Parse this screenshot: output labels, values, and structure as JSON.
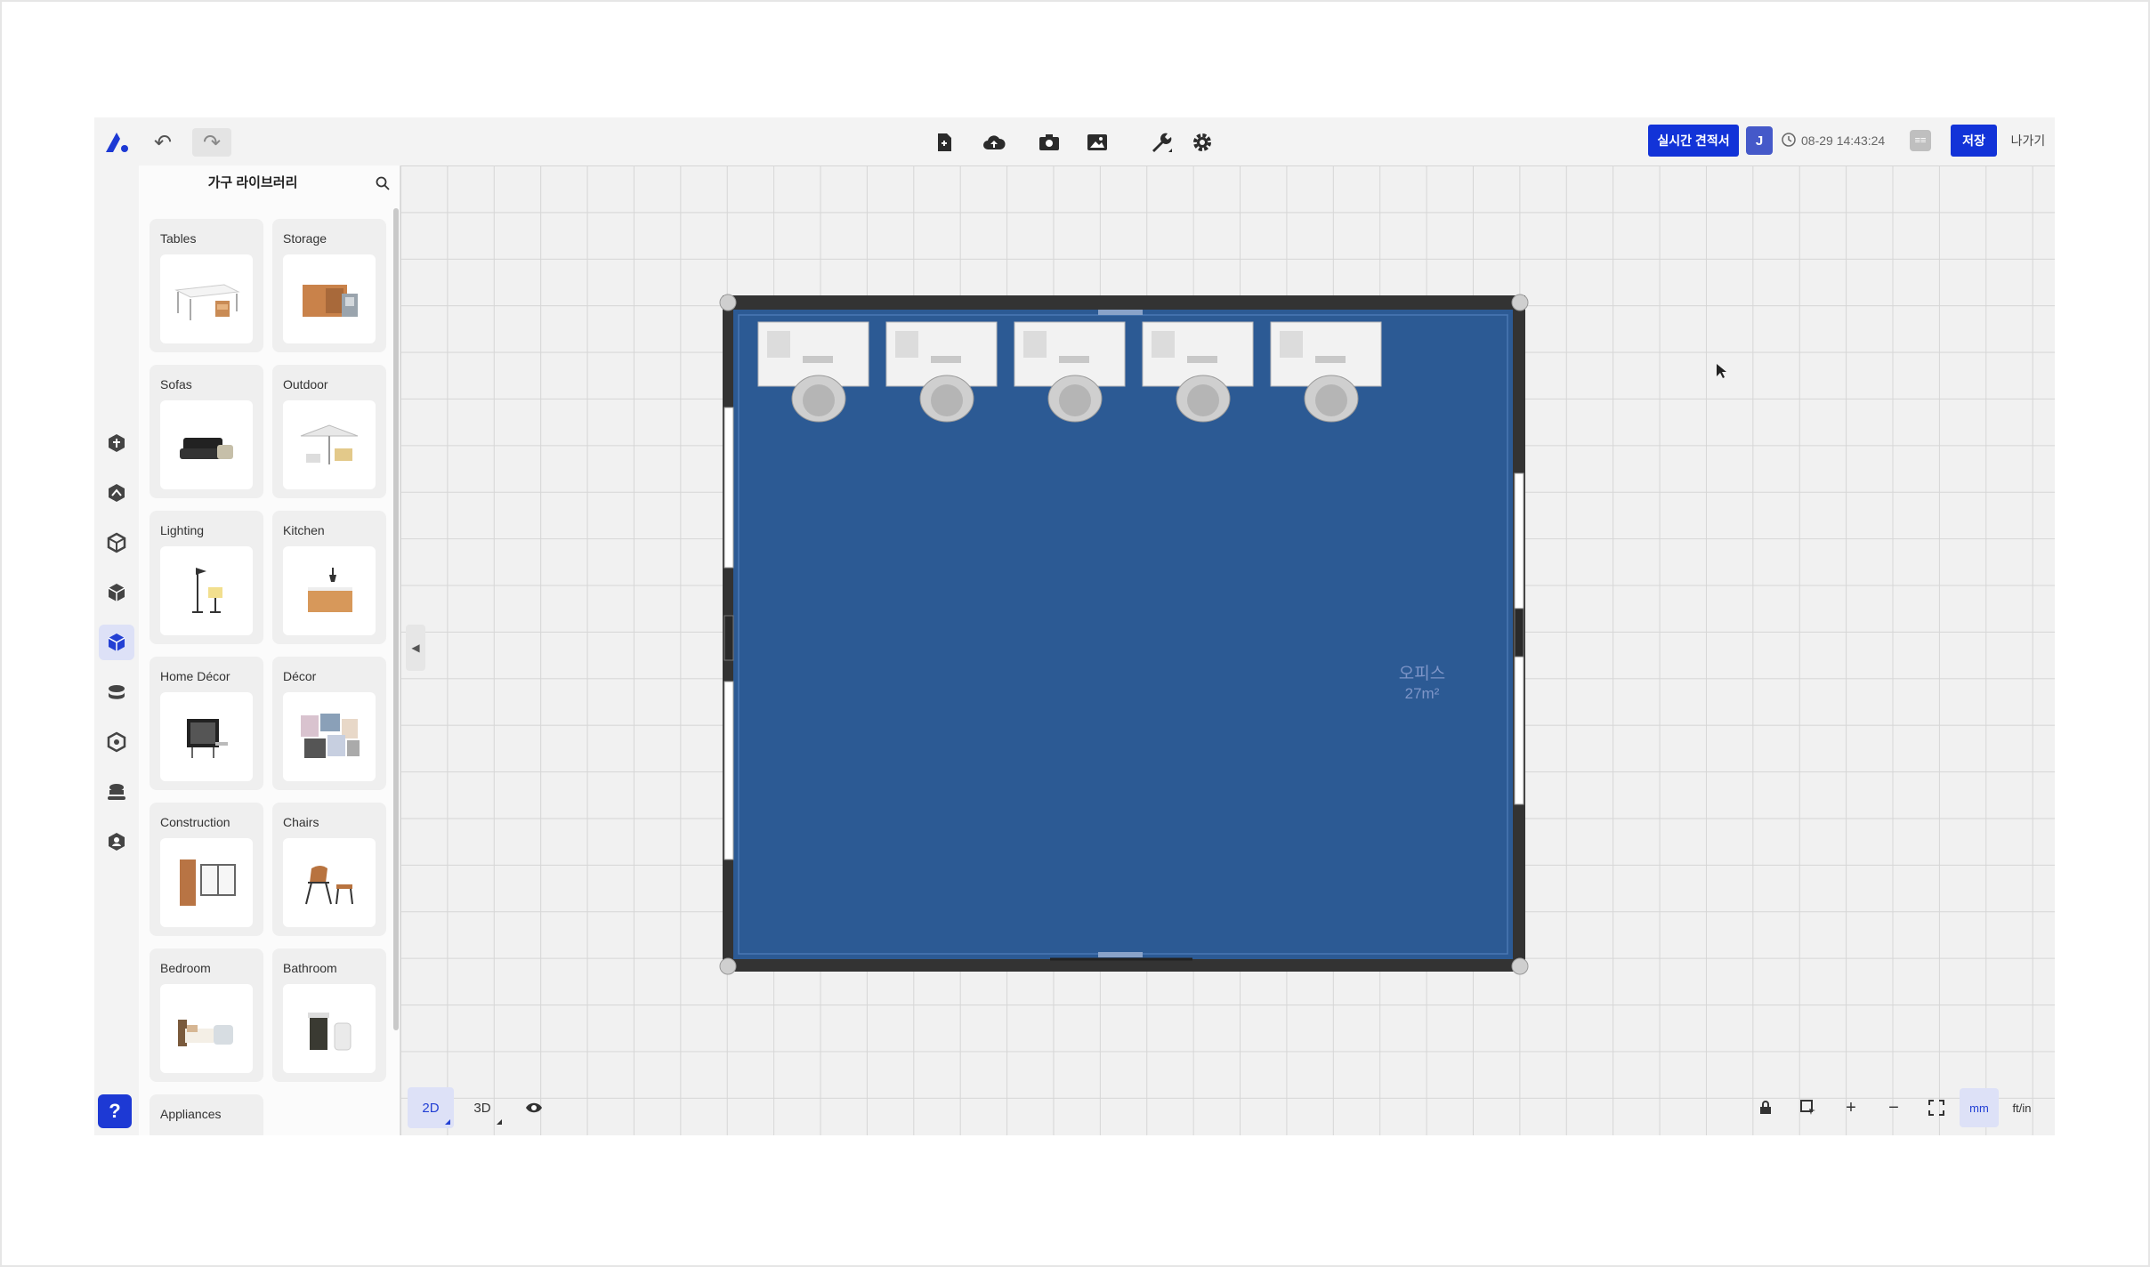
{
  "topbar": {
    "logo": "app-logo",
    "undo_icon": "↶",
    "redo_icon": "↷",
    "quote_label": "실시간 견적서",
    "user_initial": "J",
    "save_time": "08-29 14:43:24",
    "history_label": "≡≡",
    "save_label": "저장",
    "exit_label": "나가기"
  },
  "library": {
    "title": "가구 라이브러리",
    "categories": [
      {
        "label": "Tables"
      },
      {
        "label": "Storage"
      },
      {
        "label": "Sofas"
      },
      {
        "label": "Outdoor"
      },
      {
        "label": "Lighting"
      },
      {
        "label": "Kitchen"
      },
      {
        "label": "Home Décor"
      },
      {
        "label": "Décor"
      },
      {
        "label": "Construction"
      },
      {
        "label": "Chairs"
      },
      {
        "label": "Bedroom"
      },
      {
        "label": "Bathroom"
      },
      {
        "label": "Appliances"
      }
    ]
  },
  "rail": {
    "help_label": "?"
  },
  "canvas": {
    "room_name": "오피스",
    "room_area": "27m²",
    "desk_count": 5,
    "floor_color": "#2c5a94",
    "wall_color": "#333333"
  },
  "viewbar": {
    "btn_2d": "2D",
    "btn_3d": "3D"
  },
  "zoombar": {
    "plus": "+",
    "minus": "−",
    "unit_mm": "mm",
    "unit_ftin": "ft/in"
  },
  "colors": {
    "accent": "#1233d8",
    "active_bg": "#dde1f7"
  }
}
